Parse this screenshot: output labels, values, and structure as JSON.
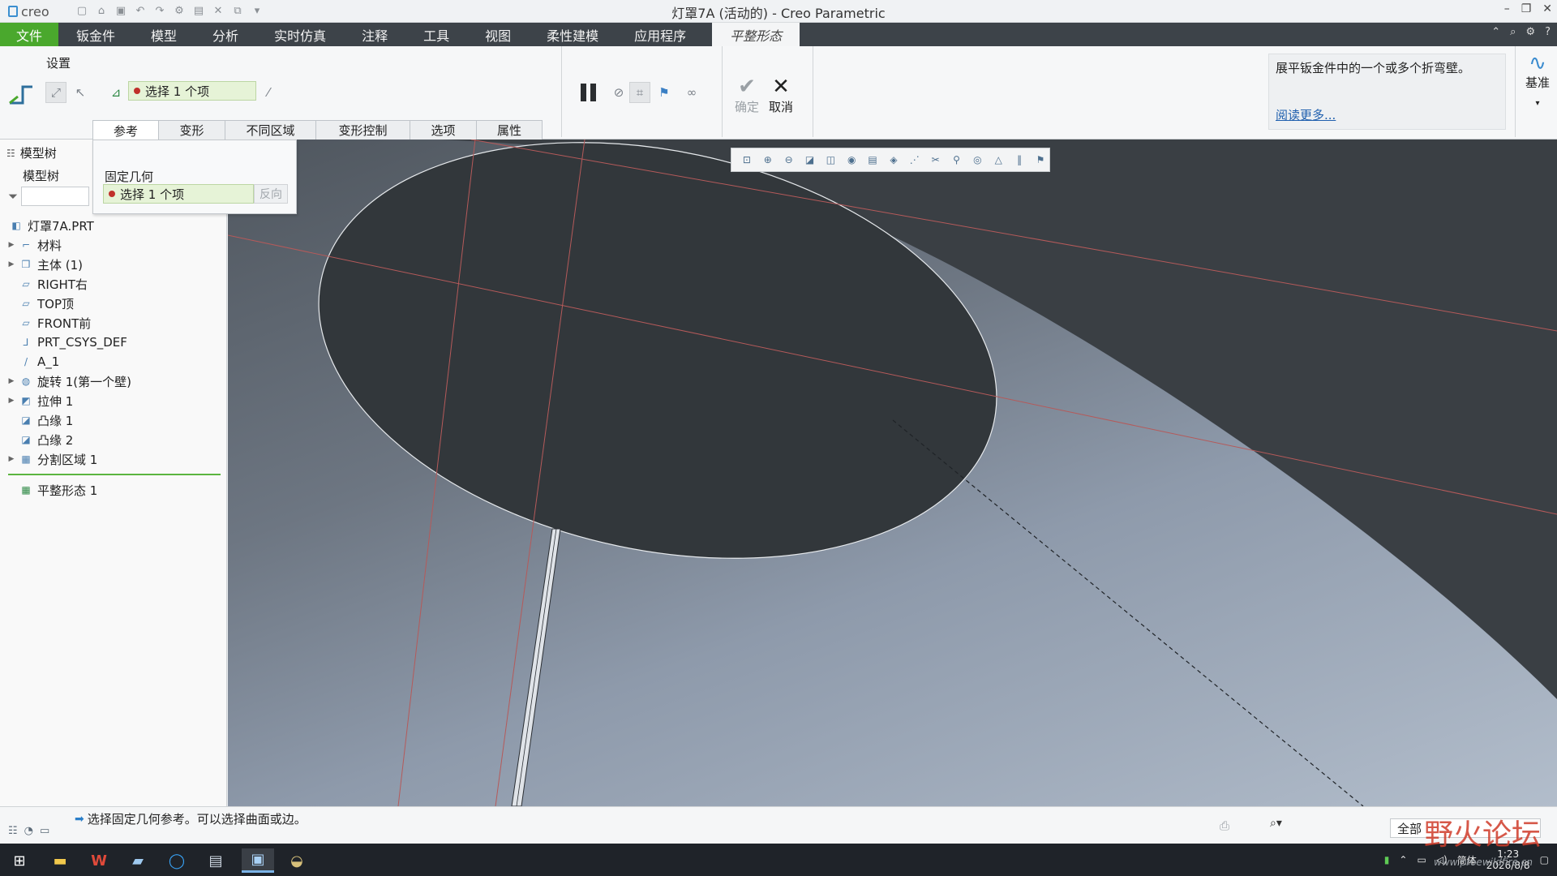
{
  "app": {
    "logo": "creo",
    "window_title": "灯罩7A (活动的) - Creo Parametric"
  },
  "menu": {
    "file": "文件",
    "items": [
      "钣金件",
      "模型",
      "分析",
      "实时仿真",
      "注释",
      "工具",
      "视图",
      "柔性建模",
      "应用程序"
    ],
    "active_tab": "平整形态"
  },
  "ribbon": {
    "settings_label": "设置",
    "selection_text": "选择 1 个项",
    "ok_label": "确定",
    "cancel_label": "取消",
    "help_text": "展平钣金件中的一个或多个折弯壁。",
    "help_link": "阅读更多...",
    "datum_label": "基准"
  },
  "tabs": [
    "参考",
    "变形",
    "不同区域",
    "变形控制",
    "选项",
    "属性"
  ],
  "ref_panel": {
    "label": "固定几何",
    "selection_text": "选择 1 个项",
    "reverse_label": "反向"
  },
  "left_panel": {
    "header": "模型树",
    "subheader": "模型树",
    "tree": [
      {
        "label": "灯罩7A.PRT",
        "icon": "part-icon",
        "expandable": false,
        "indent": 0
      },
      {
        "label": "材料",
        "icon": "material-icon",
        "expandable": true,
        "indent": 1
      },
      {
        "label": "主体 (1)",
        "icon": "body-icon",
        "expandable": true,
        "indent": 1
      },
      {
        "label": "RIGHT右",
        "icon": "datum-plane-icon",
        "expandable": false,
        "indent": 1
      },
      {
        "label": "TOP顶",
        "icon": "datum-plane-icon",
        "expandable": false,
        "indent": 1
      },
      {
        "label": "FRONT前",
        "icon": "datum-plane-icon",
        "expandable": false,
        "indent": 1
      },
      {
        "label": "PRT_CSYS_DEF",
        "icon": "csys-icon",
        "expandable": false,
        "indent": 1
      },
      {
        "label": "A_1",
        "icon": "axis-icon",
        "expandable": false,
        "indent": 1
      },
      {
        "label": "旋转 1(第一个壁)",
        "icon": "revolve-icon",
        "expandable": true,
        "indent": 1
      },
      {
        "label": "拉伸 1",
        "icon": "extrude-icon",
        "expandable": true,
        "indent": 1
      },
      {
        "label": "凸缘 1",
        "icon": "flange-icon",
        "expandable": false,
        "indent": 1
      },
      {
        "label": "凸缘 2",
        "icon": "flange-icon",
        "expandable": false,
        "indent": 1
      },
      {
        "label": "分割区域 1",
        "icon": "split-area-icon",
        "expandable": true,
        "indent": 1
      }
    ],
    "insert_item": "平整形态 1"
  },
  "status": {
    "message": "选择固定几何参考。可以选择曲面或边。",
    "filter_value": "全部"
  },
  "taskbar": {
    "ime": "简体",
    "time": "1:23",
    "date": "2026/8/8"
  },
  "watermark": {
    "text": "野火论坛",
    "url": "www.proewildfire.cn"
  },
  "colors": {
    "file_menu": "#4aa82d",
    "menubar": "#3d4349",
    "selection_fill": "#e6f3d7",
    "selection_dot": "#c0302a",
    "link": "#1f5fae",
    "viewport_dark": "#2f3438"
  }
}
